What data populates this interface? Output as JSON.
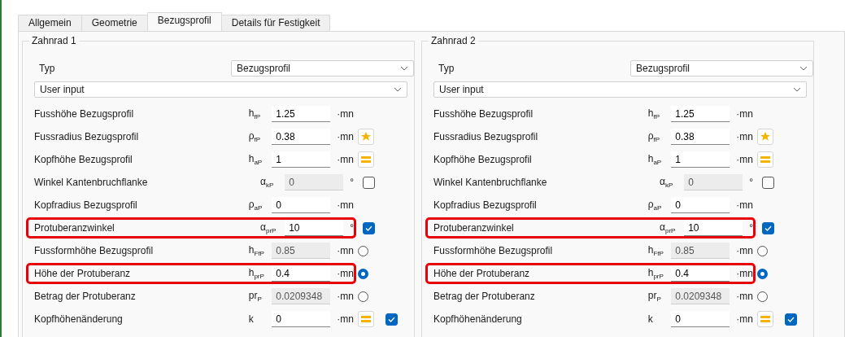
{
  "tabs": [
    {
      "label": "Allgemein",
      "selected": false
    },
    {
      "label": "Geometrie",
      "selected": false
    },
    {
      "label": "Bezugsprofil",
      "selected": true
    },
    {
      "label": "Details für Festigkeit",
      "selected": false
    }
  ],
  "groups": [
    {
      "title": "Zahnrad 1",
      "type_label": "Typ",
      "type_value": "Bezugsprofil",
      "source_value": "User input",
      "rows": [
        {
          "label": "Fusshöhe Bezugsprofil",
          "symbol": "h$_{fP}$",
          "value": "1.25",
          "disabled": false,
          "unit": "·mn",
          "highlighted": false,
          "controls": []
        },
        {
          "label": "Fussradius Bezugsprofil",
          "symbol": "ρ$_{fP}$",
          "value": "0.38",
          "disabled": false,
          "unit": "·mn",
          "highlighted": false,
          "controls": [
            {
              "kind": "star"
            }
          ]
        },
        {
          "label": "Kopfhöhe Bezugsprofil",
          "symbol": "h$_{aP}$",
          "value": "1",
          "disabled": false,
          "unit": "·mn",
          "highlighted": false,
          "controls": [
            {
              "kind": "equals"
            }
          ]
        },
        {
          "label": "Winkel Kantenbruchflanke",
          "symbol": "α$_{kP}$",
          "value": "0",
          "disabled": true,
          "unit": "°",
          "highlighted": false,
          "controls": [
            {
              "kind": "checkbox",
              "checked": false
            }
          ]
        },
        {
          "label": "Kopfradius Bezugsprofil",
          "symbol": "ρ$_{aP}$",
          "value": "0",
          "disabled": false,
          "unit": "·mn",
          "highlighted": false,
          "controls": []
        },
        {
          "label": "Protuberanzwinkel",
          "symbol": "α$_{prP}$",
          "value": "10",
          "disabled": false,
          "unit": "°",
          "highlighted": true,
          "controls": [
            {
              "kind": "checkbox",
              "checked": true
            }
          ]
        },
        {
          "label": "Fussformhöhe Bezugsprofil",
          "symbol": "h$_{FfP}$",
          "value": "0.85",
          "disabled": true,
          "unit": "·mn",
          "highlighted": false,
          "controls": [
            {
              "kind": "radio",
              "selected": false
            }
          ]
        },
        {
          "label": "Höhe der Protuberanz",
          "symbol": "h$_{prP}$",
          "value": "0.4",
          "disabled": false,
          "unit": "·mn",
          "highlighted": true,
          "controls": [
            {
              "kind": "radio",
              "selected": true
            }
          ]
        },
        {
          "label": "Betrag der Protuberanz",
          "symbol": "pr$_{P}$",
          "value": "0.0209348",
          "disabled": true,
          "unit": "·mn",
          "highlighted": false,
          "controls": [
            {
              "kind": "radio",
              "selected": false
            }
          ]
        },
        {
          "label": "Kopfhöhenänderung",
          "symbol": "k",
          "value": "0",
          "disabled": false,
          "unit": "·mn",
          "highlighted": false,
          "controls": [
            {
              "kind": "equals"
            },
            {
              "kind": "checkbox",
              "checked": true
            }
          ]
        }
      ]
    },
    {
      "title": "Zahnrad 2",
      "type_label": "Typ",
      "type_value": "Bezugsprofil",
      "source_value": "User input",
      "rows": [
        {
          "label": "Fusshöhe Bezugsprofil",
          "symbol": "h$_{fP}$",
          "value": "1.25",
          "disabled": false,
          "unit": "·mn",
          "highlighted": false,
          "controls": []
        },
        {
          "label": "Fussradius Bezugsprofil",
          "symbol": "ρ$_{fP}$",
          "value": "0.38",
          "disabled": false,
          "unit": "·mn",
          "highlighted": false,
          "controls": [
            {
              "kind": "star"
            }
          ]
        },
        {
          "label": "Kopfhöhe Bezugsprofil",
          "symbol": "h$_{aP}$",
          "value": "1",
          "disabled": false,
          "unit": "·mn",
          "highlighted": false,
          "controls": [
            {
              "kind": "equals"
            }
          ]
        },
        {
          "label": "Winkel Kantenbruchflanke",
          "symbol": "α$_{kP}$",
          "value": "0",
          "disabled": true,
          "unit": "°",
          "highlighted": false,
          "controls": [
            {
              "kind": "checkbox",
              "checked": false
            }
          ]
        },
        {
          "label": "Kopfradius Bezugsprofil",
          "symbol": "ρ$_{aP}$",
          "value": "0",
          "disabled": false,
          "unit": "·mn",
          "highlighted": false,
          "controls": []
        },
        {
          "label": "Protuberanzwinkel",
          "symbol": "α$_{prP}$",
          "value": "10",
          "disabled": false,
          "unit": "°",
          "highlighted": true,
          "controls": [
            {
              "kind": "checkbox",
              "checked": true
            }
          ]
        },
        {
          "label": "Fussformhöhe Bezugsprofil",
          "symbol": "h$_{FfP}$",
          "value": "0.85",
          "disabled": true,
          "unit": "·mn",
          "highlighted": false,
          "controls": [
            {
              "kind": "radio",
              "selected": false
            }
          ]
        },
        {
          "label": "Höhe der Protuberanz",
          "symbol": "h$_{prP}$",
          "value": "0.4",
          "disabled": false,
          "unit": "·mn",
          "highlighted": true,
          "controls": [
            {
              "kind": "radio",
              "selected": true
            }
          ]
        },
        {
          "label": "Betrag der Protuberanz",
          "symbol": "pr$_{P}$",
          "value": "0.0209348",
          "disabled": true,
          "unit": "·mn",
          "highlighted": false,
          "controls": [
            {
              "kind": "radio",
              "selected": false
            }
          ]
        },
        {
          "label": "Kopfhöhenänderung",
          "symbol": "k",
          "value": "0",
          "disabled": false,
          "unit": "·mn",
          "highlighted": false,
          "controls": [
            {
              "kind": "equals"
            },
            {
              "kind": "checkbox",
              "checked": true
            }
          ]
        }
      ]
    }
  ]
}
